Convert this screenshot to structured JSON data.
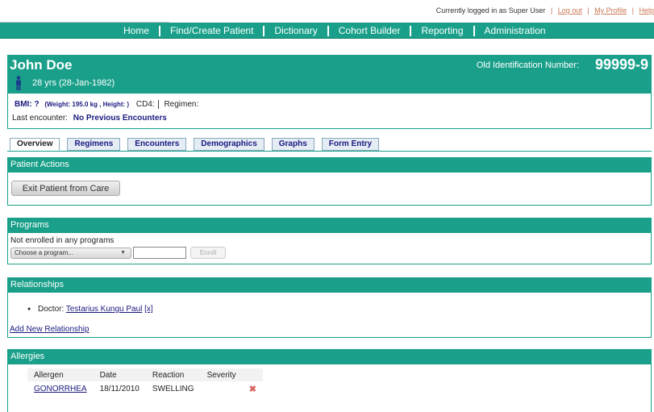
{
  "userbar": {
    "logged_in_text": "Currently logged in as Super User",
    "logout": "Log out",
    "my_profile": "My Profile",
    "help": "Help"
  },
  "nav": [
    "Home",
    "Find/Create Patient",
    "Dictionary",
    "Cohort Builder",
    "Reporting",
    "Administration"
  ],
  "patient": {
    "name": "John Doe",
    "age": "28 yrs (28-Jan-1982)",
    "old_id_label": "Old Identification Number:",
    "old_id": "99999-9",
    "bmi": "BMI: ?",
    "weight_height": "(Weight: 195.0 kg , Height: )",
    "cd4": "CD4:",
    "regimen": "Regimen:",
    "last_encounter_label": "Last encounter:",
    "last_encounter_value": "No Previous Encounters"
  },
  "tabs": [
    "Overview",
    "Regimens",
    "Encounters",
    "Demographics",
    "Graphs",
    "Form Entry"
  ],
  "patient_actions": {
    "title": "Patient Actions",
    "exit_button": "Exit Patient from Care"
  },
  "programs": {
    "title": "Programs",
    "not_enrolled": "Not enrolled in any programs",
    "select_placeholder": "Choose a program...",
    "enroll_button": "Enroll"
  },
  "relationships": {
    "title": "Relationships",
    "doctor_label": "Doctor:",
    "doctor_name": "Testarius Kungu Paul",
    "doctor_link": "[x]",
    "add_link": "Add New Relationship"
  },
  "allergies": {
    "title": "Allergies",
    "columns": [
      "Allergen",
      "Date",
      "Reaction",
      "Severity"
    ],
    "rows": [
      {
        "allergen": "GONORRHEA",
        "date": "18/11/2010",
        "reaction": "SWELLING",
        "severity": ""
      }
    ]
  },
  "colors": {
    "accent": "#1aa08a",
    "link": "#1a1a80",
    "userbar_link": "#cc7755"
  }
}
